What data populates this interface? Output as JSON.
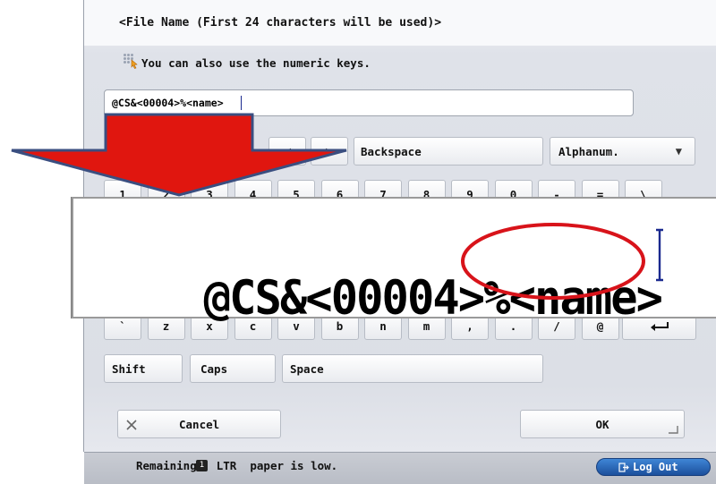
{
  "dialog": {
    "title": "<File Name (First 24 characters will be used)>",
    "hint": "You can also use the numeric keys.",
    "hint_icon": "numeric-keypad-icon"
  },
  "input": {
    "value": "@CS&<00004>%<name>"
  },
  "controls": {
    "left_arrow": "◀",
    "right_arrow": "▶",
    "backspace": "Backspace",
    "mode": {
      "selected": "Alphanum.",
      "chevron": "▼"
    }
  },
  "keyboard": {
    "row1": [
      "1",
      "2",
      "3",
      "4",
      "5",
      "6",
      "7",
      "8",
      "9",
      "0",
      "-",
      "=",
      "\\"
    ],
    "row4": [
      "`",
      "z",
      "x",
      "c",
      "v",
      "b",
      "n",
      "m",
      ",",
      ".",
      "/",
      "@"
    ],
    "shift": "Shift",
    "caps": "Caps",
    "space": "Space",
    "enter_icon": "enter-arrow-icon"
  },
  "zoom": {
    "prefix": "@CS&<00004>%",
    "highlighted": "<name>",
    "highlight_color": "#d8131a",
    "arrow_color": "#e0160f",
    "arrow_outline": "#3a4e80"
  },
  "footer": {
    "cancel": "Cancel",
    "cancel_icon": "close-icon",
    "ok": "OK",
    "status_before": "Remaining",
    "status_badge": "1",
    "status_after": "LTR  paper is low.",
    "logout": "Log Out"
  }
}
